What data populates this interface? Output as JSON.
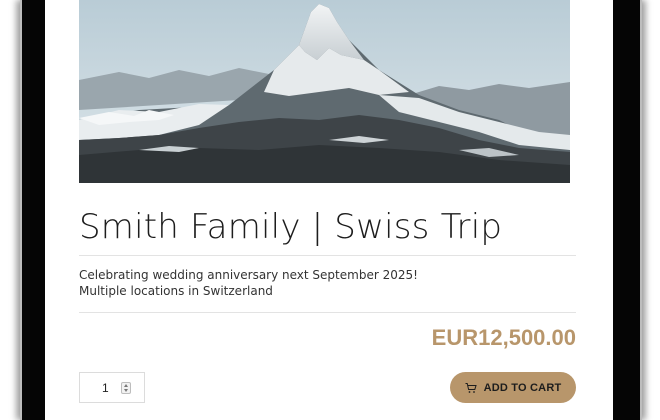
{
  "product": {
    "title": "Smith Family | Swiss Trip",
    "description_lines": [
      "Celebrating wedding anniversary next September 2025!",
      "Multiple locations in Switzerland"
    ],
    "price": "EUR12,500.00",
    "image_alt": "Matterhorn mountain peak with snow"
  },
  "quantity": {
    "value": "1",
    "icon": "stepper-icon"
  },
  "cart_button": {
    "label": "ADD TO CART",
    "icon": "shopping-cart-icon"
  },
  "colors": {
    "accent": "#b8966b",
    "text": "#1d1d1d",
    "bezel": "#050505"
  }
}
